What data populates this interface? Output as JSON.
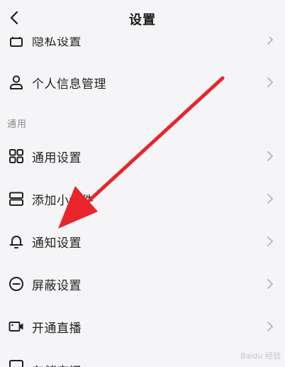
{
  "header": {
    "title": "设置",
    "back_icon": "chevron-left-icon"
  },
  "section_general_label": "通用",
  "rows": [
    {
      "label": "隐私设置",
      "icon": "lock-icon"
    },
    {
      "label": "个人信息管理",
      "icon": "person-icon"
    },
    {
      "label": "通用设置",
      "icon": "grid-icon"
    },
    {
      "label": "添加小组件",
      "icon": "widget-icon"
    },
    {
      "label": "通知设置",
      "icon": "bell-icon"
    },
    {
      "label": "屏蔽设置",
      "icon": "block-icon"
    },
    {
      "label": "开通直播",
      "icon": "live-camera-icon"
    },
    {
      "label": "存储空间",
      "icon": "storage-icon"
    }
  ],
  "colors": {
    "background": "#f5f5f7",
    "text": "#222222",
    "chevron": "#b5b5b5",
    "annotation_arrow": "#e8252b"
  }
}
